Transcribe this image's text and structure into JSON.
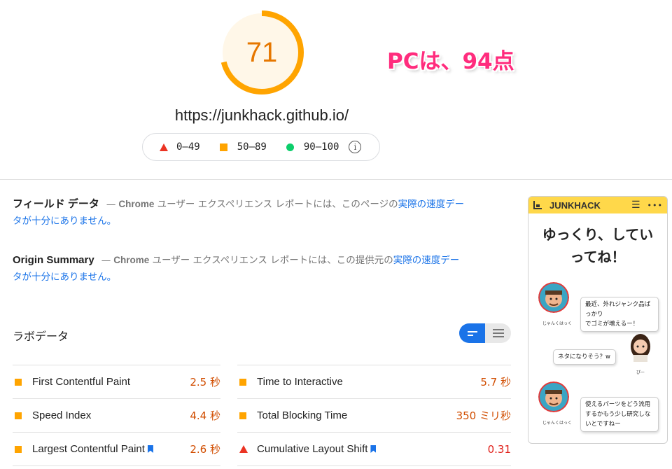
{
  "score": "71",
  "annotation": "PCは、94点",
  "url": "https://junkhack.github.io/",
  "legend": {
    "fail": "0–49",
    "average": "50–89",
    "pass": "90–100"
  },
  "field_data": {
    "heading": "フィールド データ",
    "dash": "—",
    "chrome": "Chrome",
    "text": " ユーザー エクスペリエンス レポートには、このページの",
    "link_a": "実際の速度デー",
    "link_b": "タが十分にありません。"
  },
  "origin_summary": {
    "heading": "Origin Summary",
    "dash": "—",
    "chrome": "Chrome",
    "text": " ユーザー エクスペリエンス レポートには、この提供元の",
    "link_a": "実際の速度デー",
    "link_b": "タが十分にありません。"
  },
  "lab": {
    "title": "ラボデータ"
  },
  "metrics_left": [
    {
      "label": "First Contentful Paint",
      "value": "2.5 秒"
    },
    {
      "label": "Speed Index",
      "value": "4.4 秒"
    },
    {
      "label": "Largest Contentful Paint",
      "value": "2.6 秒"
    }
  ],
  "metrics_right": [
    {
      "label": "Time to Interactive",
      "value": "5.7 秒"
    },
    {
      "label": "Total Blocking Time",
      "value": "350 ミリ秒"
    },
    {
      "label": "Cumulative Layout Shift",
      "value": "0.31"
    }
  ],
  "preview": {
    "logo": "JUNKHACK",
    "headline_1": "ゆっくり、してい",
    "headline_2": "ってね！",
    "bubble_1_a": "最近、外れジャンク品ばっかり",
    "bubble_1_b": "でゴミが増えるー！",
    "bubble_2": "ネタになりそう？w",
    "bubble_3_a": "使えるパーツをどう流用",
    "bubble_3_b": "するかもう少し研究しな",
    "bubble_3_c": "いとですねー",
    "name_1": "じゃんくはっく",
    "name_2": "ぴー",
    "name_3": "じゃんくはっく"
  },
  "colors": {
    "score_orange": "#ffa400",
    "score_text": "#e67700",
    "annotation_pink": "#ff2c7d",
    "link_blue": "#1a73e8",
    "fail_red": "#eb3323",
    "pass_green": "#0cce6b",
    "header_yellow": "#ffd84a"
  }
}
